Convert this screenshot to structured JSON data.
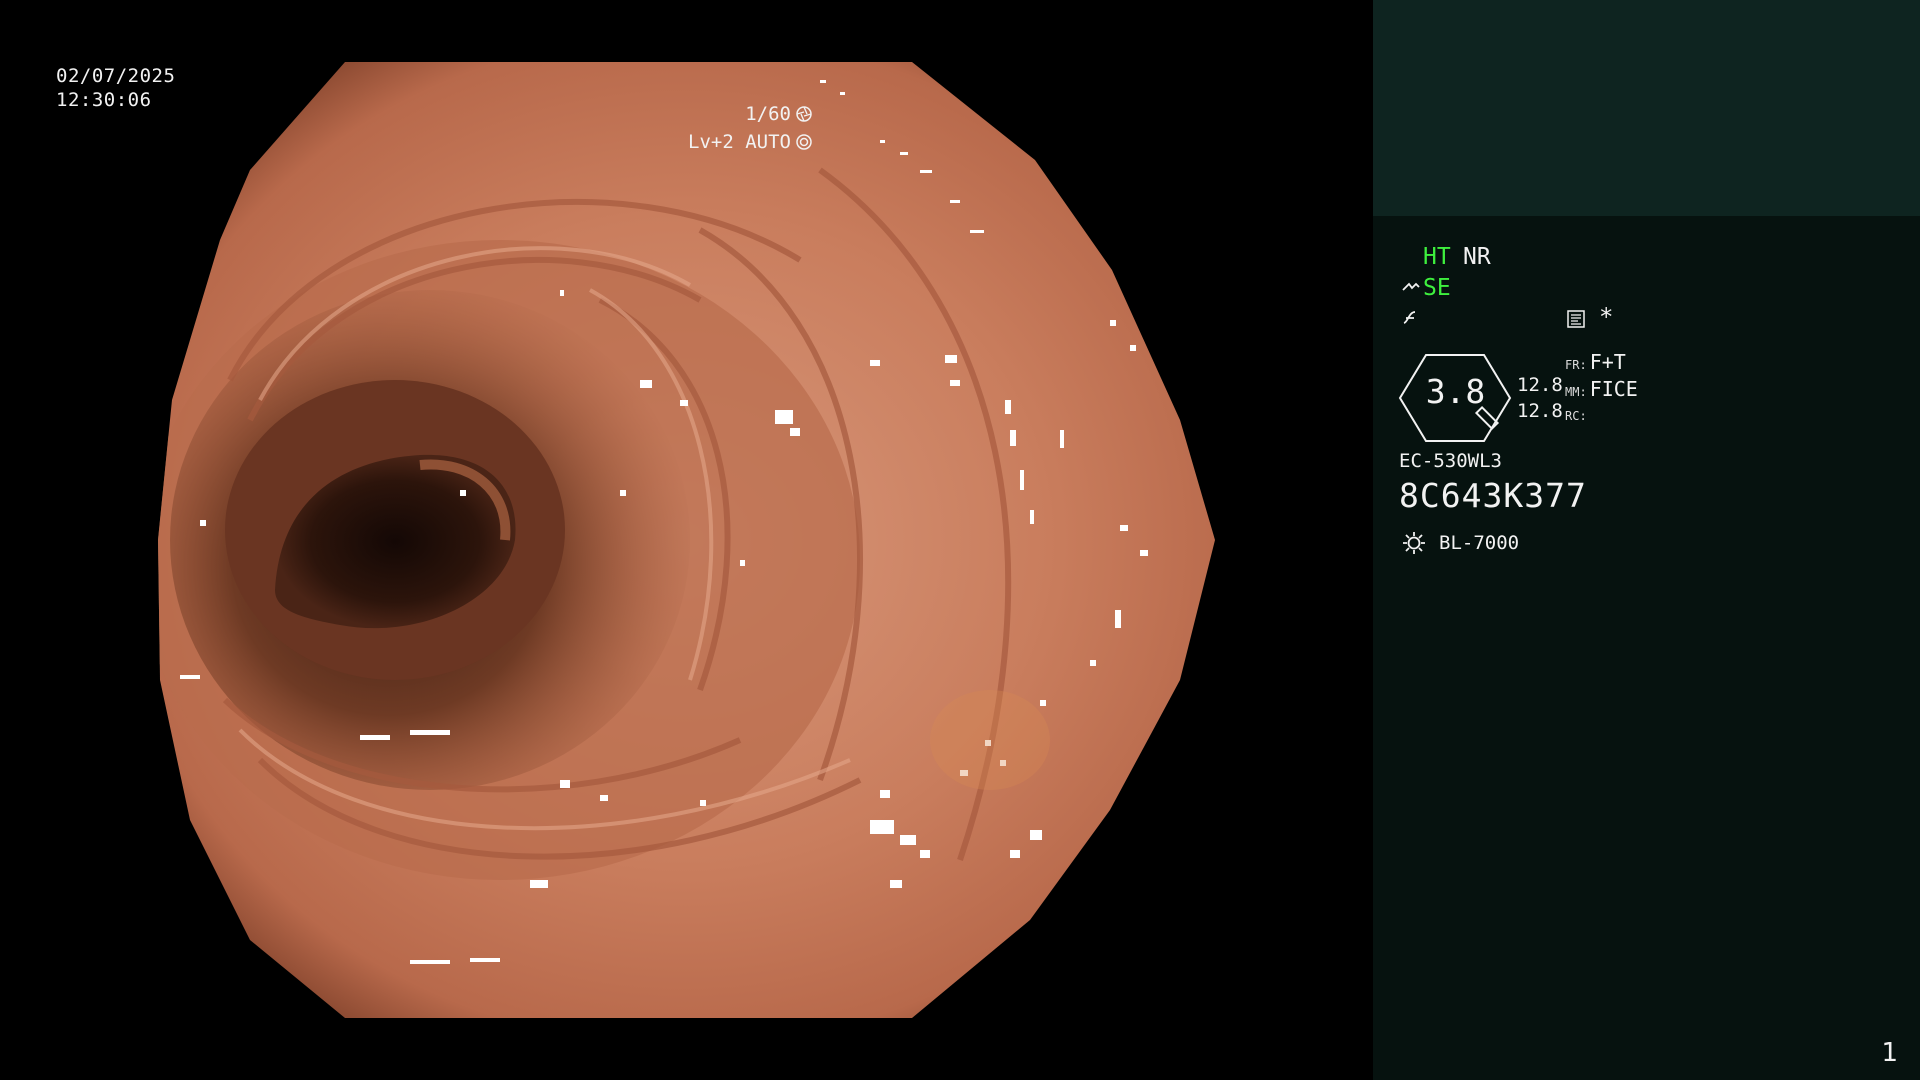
{
  "scope": {
    "date": "02/07/2025",
    "time": "12:30:06",
    "shutter": "1/60",
    "level": "Lv+2 AUTO"
  },
  "status": {
    "ht": "HT",
    "nr": "NR",
    "se": "SE",
    "asterisk": "*",
    "gauge_value": "3.8",
    "value_1": "12.8",
    "value_2": "12.8",
    "fr_label": "FR:",
    "fr_value": "F+T",
    "mm_label": "MM:",
    "mm_value": "FICE",
    "rc_label": "RC:",
    "model": "EC-530WL3",
    "serial": "8C643K377",
    "light_source": "BL-7000",
    "page_number": "1"
  },
  "colors": {
    "status_green": "#3ef03e",
    "panel_bg": "#06120f",
    "panel_top_bg": "#0e2420"
  }
}
